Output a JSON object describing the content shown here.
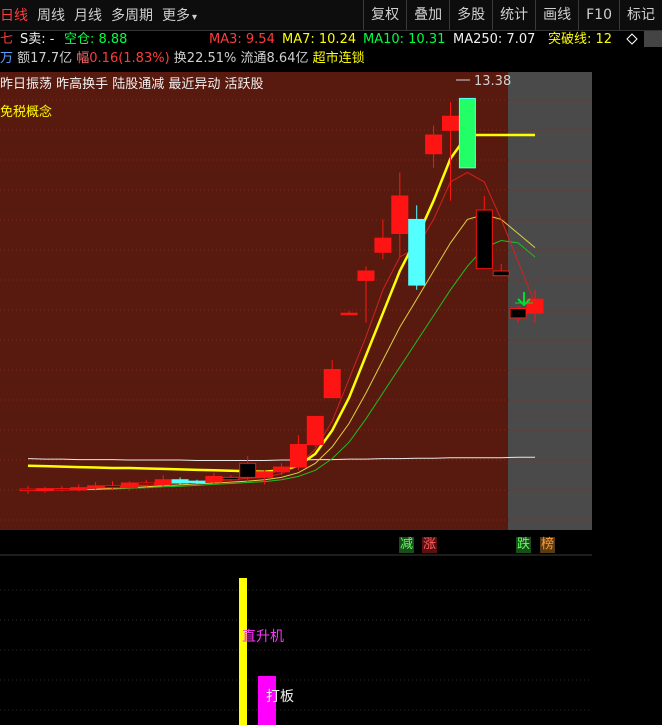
{
  "toolbar": {
    "left_tabs": [
      "日线",
      "周线",
      "月线",
      "多周期",
      "更多"
    ],
    "right_tabs": [
      "复权",
      "叠加",
      "多股",
      "统计",
      "画线",
      "F10",
      "标记"
    ]
  },
  "ma_row": {
    "partial_prefix": "七",
    "label_sell": "S卖: -",
    "label_position": "空仓: 8.88",
    "ma3": "MA3: 9.54",
    "ma7": "MA7: 10.24",
    "ma10": "MA10: 10.31",
    "ma250": "MA250: 7.07",
    "breakout": "突破线: 12"
  },
  "info_row": {
    "partial_prefix": "万",
    "amount": "额17.7亿",
    "change_label": "幅",
    "change_value": "0.16(1.83%)",
    "turnover": "换22.51%",
    "float_value": "流通8.64亿",
    "concept": "超市连锁"
  },
  "tags": {
    "line1": "昨日振荡 昨高换手 陆股通减 最近异动 活跃股",
    "line2": "免税概念"
  },
  "chart_data": {
    "type": "candlestick",
    "high_marker": "13.38",
    "candles": [
      {
        "o": 5.05,
        "h": 5.12,
        "l": 4.95,
        "c": 5.02
      },
      {
        "o": 5.02,
        "h": 5.1,
        "l": 4.97,
        "c": 5.06
      },
      {
        "o": 5.06,
        "h": 5.12,
        "l": 5.0,
        "c": 5.03
      },
      {
        "o": 5.03,
        "h": 5.15,
        "l": 5.0,
        "c": 5.08
      },
      {
        "o": 5.08,
        "h": 5.2,
        "l": 5.02,
        "c": 5.12
      },
      {
        "o": 5.12,
        "h": 5.22,
        "l": 5.05,
        "c": 5.08
      },
      {
        "o": 5.08,
        "h": 5.22,
        "l": 5.02,
        "c": 5.18
      },
      {
        "o": 5.18,
        "h": 5.25,
        "l": 5.1,
        "c": 5.14
      },
      {
        "o": 5.14,
        "h": 5.35,
        "l": 5.1,
        "c": 5.25
      },
      {
        "o": 5.25,
        "h": 5.3,
        "l": 5.15,
        "c": 5.18
      },
      {
        "o": 5.22,
        "h": 5.25,
        "l": 5.15,
        "c": 5.2
      },
      {
        "o": 5.2,
        "h": 5.4,
        "l": 5.15,
        "c": 5.32
      },
      {
        "o": 5.3,
        "h": 5.35,
        "l": 5.2,
        "c": 5.25
      },
      {
        "o": 5.6,
        "h": 5.75,
        "l": 5.2,
        "c": 5.3
      },
      {
        "o": 5.3,
        "h": 5.45,
        "l": 5.15,
        "c": 5.42
      },
      {
        "o": 5.42,
        "h": 5.6,
        "l": 5.35,
        "c": 5.52
      },
      {
        "o": 5.52,
        "h": 6.2,
        "l": 5.45,
        "c": 6.0
      },
      {
        "o": 6.0,
        "h": 6.6,
        "l": 5.95,
        "c": 6.6
      },
      {
        "o": 7.0,
        "h": 7.8,
        "l": 7.0,
        "c": 7.6
      },
      {
        "o": 8.8,
        "h": 8.85,
        "l": 8.8,
        "c": 8.8
      },
      {
        "o": 9.5,
        "h": 9.8,
        "l": 8.6,
        "c": 9.7
      },
      {
        "o": 10.1,
        "h": 10.8,
        "l": 9.95,
        "c": 10.4
      },
      {
        "o": 10.5,
        "h": 11.8,
        "l": 10.0,
        "c": 11.3
      },
      {
        "o": 10.8,
        "h": 11.1,
        "l": 9.3,
        "c": 9.4
      },
      {
        "o": 12.2,
        "h": 12.8,
        "l": 11.9,
        "c": 12.6
      },
      {
        "o": 12.7,
        "h": 13.3,
        "l": 11.2,
        "c": 13.0
      },
      {
        "o": 13.38,
        "h": 13.38,
        "l": 11.9,
        "c": 11.9
      },
      {
        "o": 11.0,
        "h": 11.3,
        "l": 9.75,
        "c": 9.75
      },
      {
        "o": 9.7,
        "h": 9.85,
        "l": 9.6,
        "c": 9.6
      },
      {
        "o": 8.9,
        "h": 8.95,
        "l": 8.6,
        "c": 8.7
      },
      {
        "o": 8.8,
        "h": 9.3,
        "l": 8.6,
        "c": 9.1
      }
    ],
    "future_start_index": 27,
    "ma_breakout": [
      5.55,
      5.54,
      5.53,
      5.52,
      5.51,
      5.5,
      5.5,
      5.49,
      5.48,
      5.47,
      5.46,
      5.45,
      5.44,
      5.43,
      5.42,
      5.45,
      5.55,
      5.8,
      6.3,
      7.0,
      7.9,
      8.8,
      9.7,
      10.4,
      11.2,
      12.1,
      12.6,
      12.6,
      12.6,
      12.6,
      12.6
    ],
    "ma250": [
      5.7,
      5.69,
      5.69,
      5.68,
      5.68,
      5.68,
      5.67,
      5.67,
      5.67,
      5.67,
      5.66,
      5.66,
      5.66,
      5.66,
      5.66,
      5.67,
      5.67,
      5.68,
      5.68,
      5.69,
      5.69,
      5.7,
      5.7,
      5.71,
      5.71,
      5.72,
      5.72,
      5.72,
      5.72,
      5.73,
      5.73
    ],
    "ma3": [
      5.03,
      5.04,
      5.04,
      5.05,
      5.07,
      5.09,
      5.12,
      5.13,
      5.16,
      5.19,
      5.2,
      5.23,
      5.25,
      5.28,
      5.3,
      5.38,
      5.55,
      5.9,
      6.5,
      7.4,
      8.3,
      9.3,
      10.0,
      10.2,
      10.8,
      11.6,
      11.8,
      11.6,
      10.8,
      9.9,
      9.0
    ],
    "ma7": [
      5.03,
      5.03,
      5.04,
      5.04,
      5.05,
      5.07,
      5.08,
      5.1,
      5.12,
      5.14,
      5.16,
      5.18,
      5.2,
      5.22,
      5.25,
      5.3,
      5.4,
      5.6,
      5.95,
      6.45,
      7.1,
      7.8,
      8.5,
      9.1,
      9.7,
      10.3,
      10.8,
      10.9,
      10.8,
      10.5,
      10.2
    ],
    "ma10": [
      5.02,
      5.03,
      5.03,
      5.04,
      5.04,
      5.05,
      5.07,
      5.08,
      5.1,
      5.11,
      5.13,
      5.15,
      5.17,
      5.19,
      5.21,
      5.25,
      5.32,
      5.45,
      5.7,
      6.05,
      6.55,
      7.1,
      7.65,
      8.2,
      8.75,
      9.3,
      9.8,
      10.2,
      10.35,
      10.3,
      10.0
    ]
  },
  "signals": {
    "s1": "减",
    "s2": "涨",
    "s3": "跌",
    "s4": "榜"
  },
  "indicator": {
    "label1": "直升机",
    "label2": "打板"
  },
  "colors": {
    "up": "#ff1414",
    "down_fill": "#000000",
    "down_cyan": "#54ffff",
    "bg_chart": "#581a0e",
    "bg_future": "#4a4a4a"
  }
}
